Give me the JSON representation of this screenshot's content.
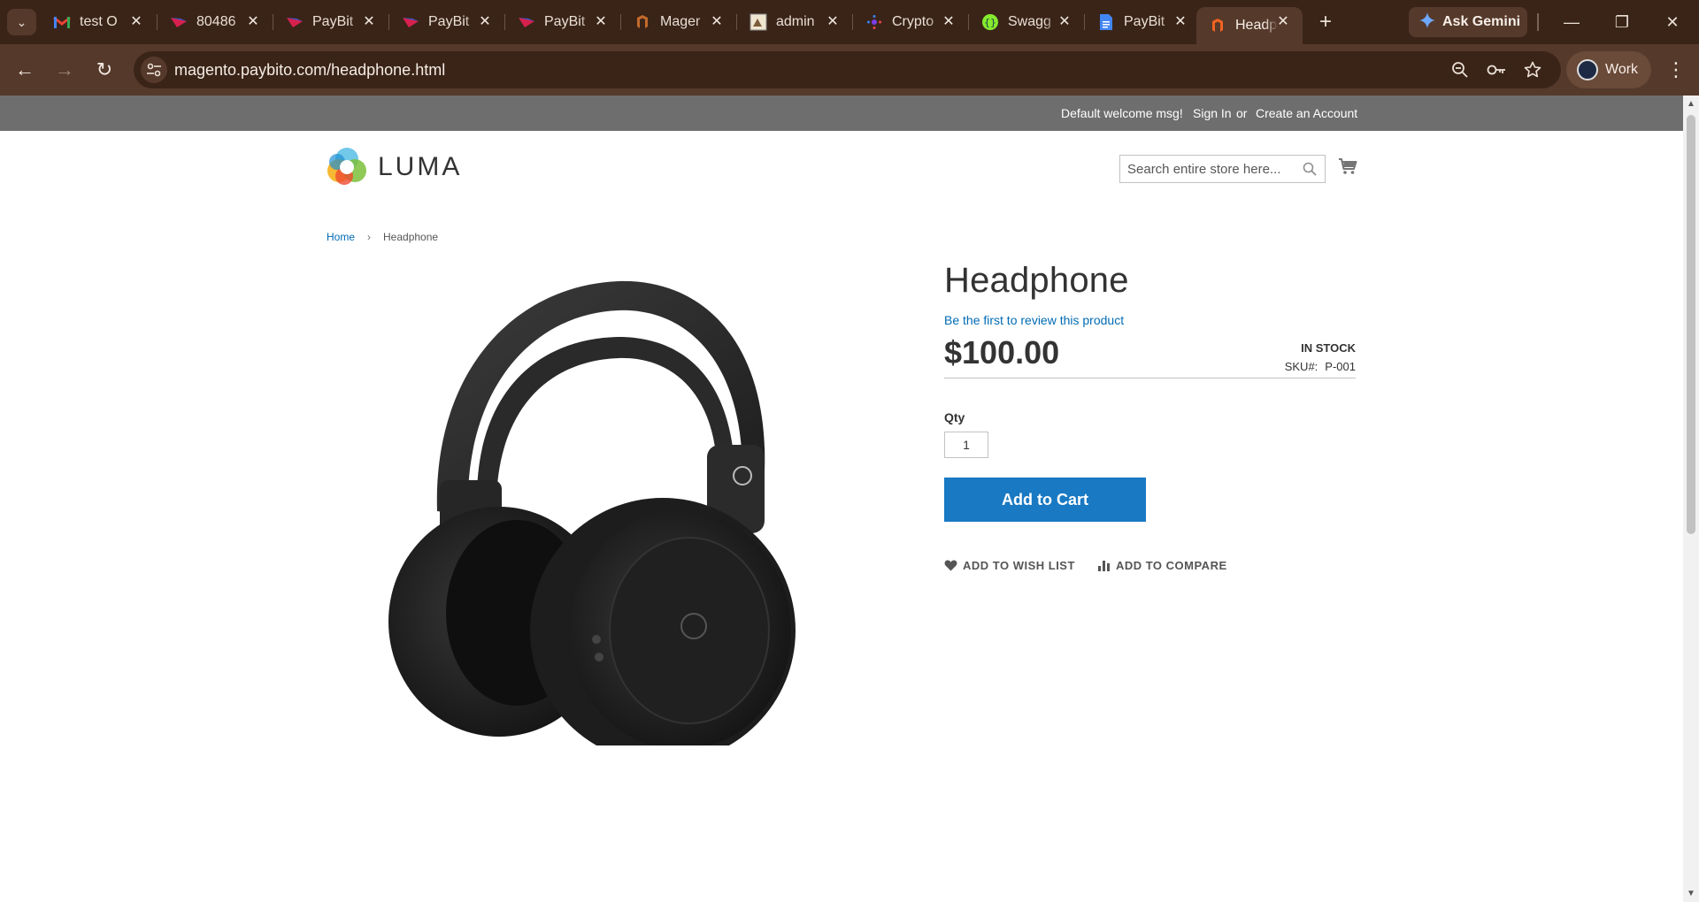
{
  "browser": {
    "tabs": [
      {
        "title": "test O",
        "icon": "gmail-icon"
      },
      {
        "title": "80486",
        "icon": "paybito-icon"
      },
      {
        "title": "PayBit",
        "icon": "paybito-icon"
      },
      {
        "title": "PayBit",
        "icon": "paybito-icon"
      },
      {
        "title": "PayBit",
        "icon": "paybito-icon"
      },
      {
        "title": "Mager",
        "icon": "magento-icon"
      },
      {
        "title": "admin",
        "icon": "admin-icon"
      },
      {
        "title": "Crypto",
        "icon": "crypto-icon"
      },
      {
        "title": "Swagg",
        "icon": "swagger-icon"
      },
      {
        "title": "PayBit",
        "icon": "docs-icon"
      },
      {
        "title": "Headp",
        "icon": "magento-icon",
        "active": true
      }
    ],
    "gemini_label": "Ask Gemini",
    "url": "magento.paybito.com/headphone.html",
    "profile_label": "Work"
  },
  "header": {
    "welcome": "Default welcome msg!",
    "sign_in": "Sign In",
    "or": "or",
    "create_account": "Create an Account"
  },
  "logo": {
    "text": "LUMA"
  },
  "search": {
    "placeholder": "Search entire store here..."
  },
  "breadcrumbs": {
    "home": "Home",
    "separator": "›",
    "current": "Headphone"
  },
  "product": {
    "title": "Headphone",
    "review_link": "Be the first to review this product",
    "price": "$100.00",
    "stock": "IN STOCK",
    "sku_label": "SKU#:",
    "sku_value": "P-001",
    "qty_label": "Qty",
    "qty_value": "1",
    "add_to_cart": "Add to Cart",
    "wishlist": "ADD TO WISH LIST",
    "compare": "ADD TO COMPARE"
  },
  "colors": {
    "accent": "#1979c3",
    "link": "#006bb4",
    "header_bg": "#6e6e6e",
    "chrome_dark": "#3a2418",
    "chrome_mid": "#55392a"
  }
}
